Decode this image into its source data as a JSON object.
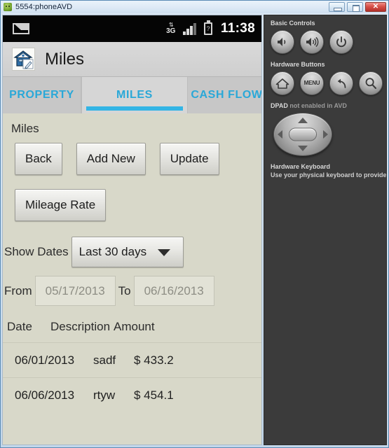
{
  "window": {
    "title": "5554:phoneAVD",
    "icon": "android-robot-icon",
    "minimize_label": "",
    "maximize_label": "",
    "close_label": "✕"
  },
  "status_bar": {
    "mail_icon": "envelope-icon",
    "network_label": "3G",
    "network_arrows": "⇅",
    "battery_label": "?",
    "clock": "11:38"
  },
  "app_header": {
    "icon": "house-edit-icon",
    "title": "Miles"
  },
  "tabs": [
    {
      "label": "PROPERTY",
      "selected": false
    },
    {
      "label": "MILES",
      "selected": true
    },
    {
      "label": "CASH FLOW",
      "selected": false
    }
  ],
  "main": {
    "section_label": "Miles",
    "buttons": [
      {
        "label": "Back"
      },
      {
        "label": "Add New"
      },
      {
        "label": "Update"
      }
    ],
    "secondary_buttons": [
      {
        "label": "Mileage Rate"
      }
    ],
    "show_dates": {
      "label": "Show Dates",
      "selected": "Last 30 days",
      "caret_icon": "chevron-down-icon"
    },
    "date_range": {
      "from_label": "From",
      "from_value": "05/17/2013",
      "to_label": "To",
      "to_value": "06/16/2013"
    },
    "table": {
      "columns": [
        "Date",
        "Description",
        "Amount"
      ],
      "rows": [
        {
          "date": "06/01/2013",
          "description": "sadf",
          "amount": "$ 433.2"
        },
        {
          "date": "06/06/2013",
          "description": "rtyw",
          "amount": "$ 454.1"
        }
      ]
    }
  },
  "control_panel": {
    "basic_controls_heading": "Basic Controls",
    "basic_controls": [
      {
        "name": "volume-down-button",
        "icon": "speaker-low-icon"
      },
      {
        "name": "volume-up-button",
        "icon": "speaker-high-icon"
      },
      {
        "name": "power-button",
        "icon": "power-icon"
      }
    ],
    "hardware_buttons_heading": "Hardware Buttons",
    "hardware_buttons": [
      {
        "name": "home-button",
        "icon": "home-icon",
        "label": ""
      },
      {
        "name": "menu-button",
        "icon": "menu-icon",
        "label": "MENU"
      },
      {
        "name": "back-button",
        "icon": "back-arrow-icon",
        "label": ""
      },
      {
        "name": "search-button",
        "icon": "search-icon",
        "label": ""
      }
    ],
    "dpad_heading_strong": "DPAD",
    "dpad_heading_muted": "not enabled in AVD",
    "keyboard_heading": "Hardware Keyboard",
    "keyboard_sub": "Use your physical keyboard to provide input"
  },
  "colors": {
    "accent_cyan": "#33b5e5",
    "app_background": "#d8d8c9",
    "panel_background": "#3b3b3b",
    "status_bar": "#050505"
  }
}
